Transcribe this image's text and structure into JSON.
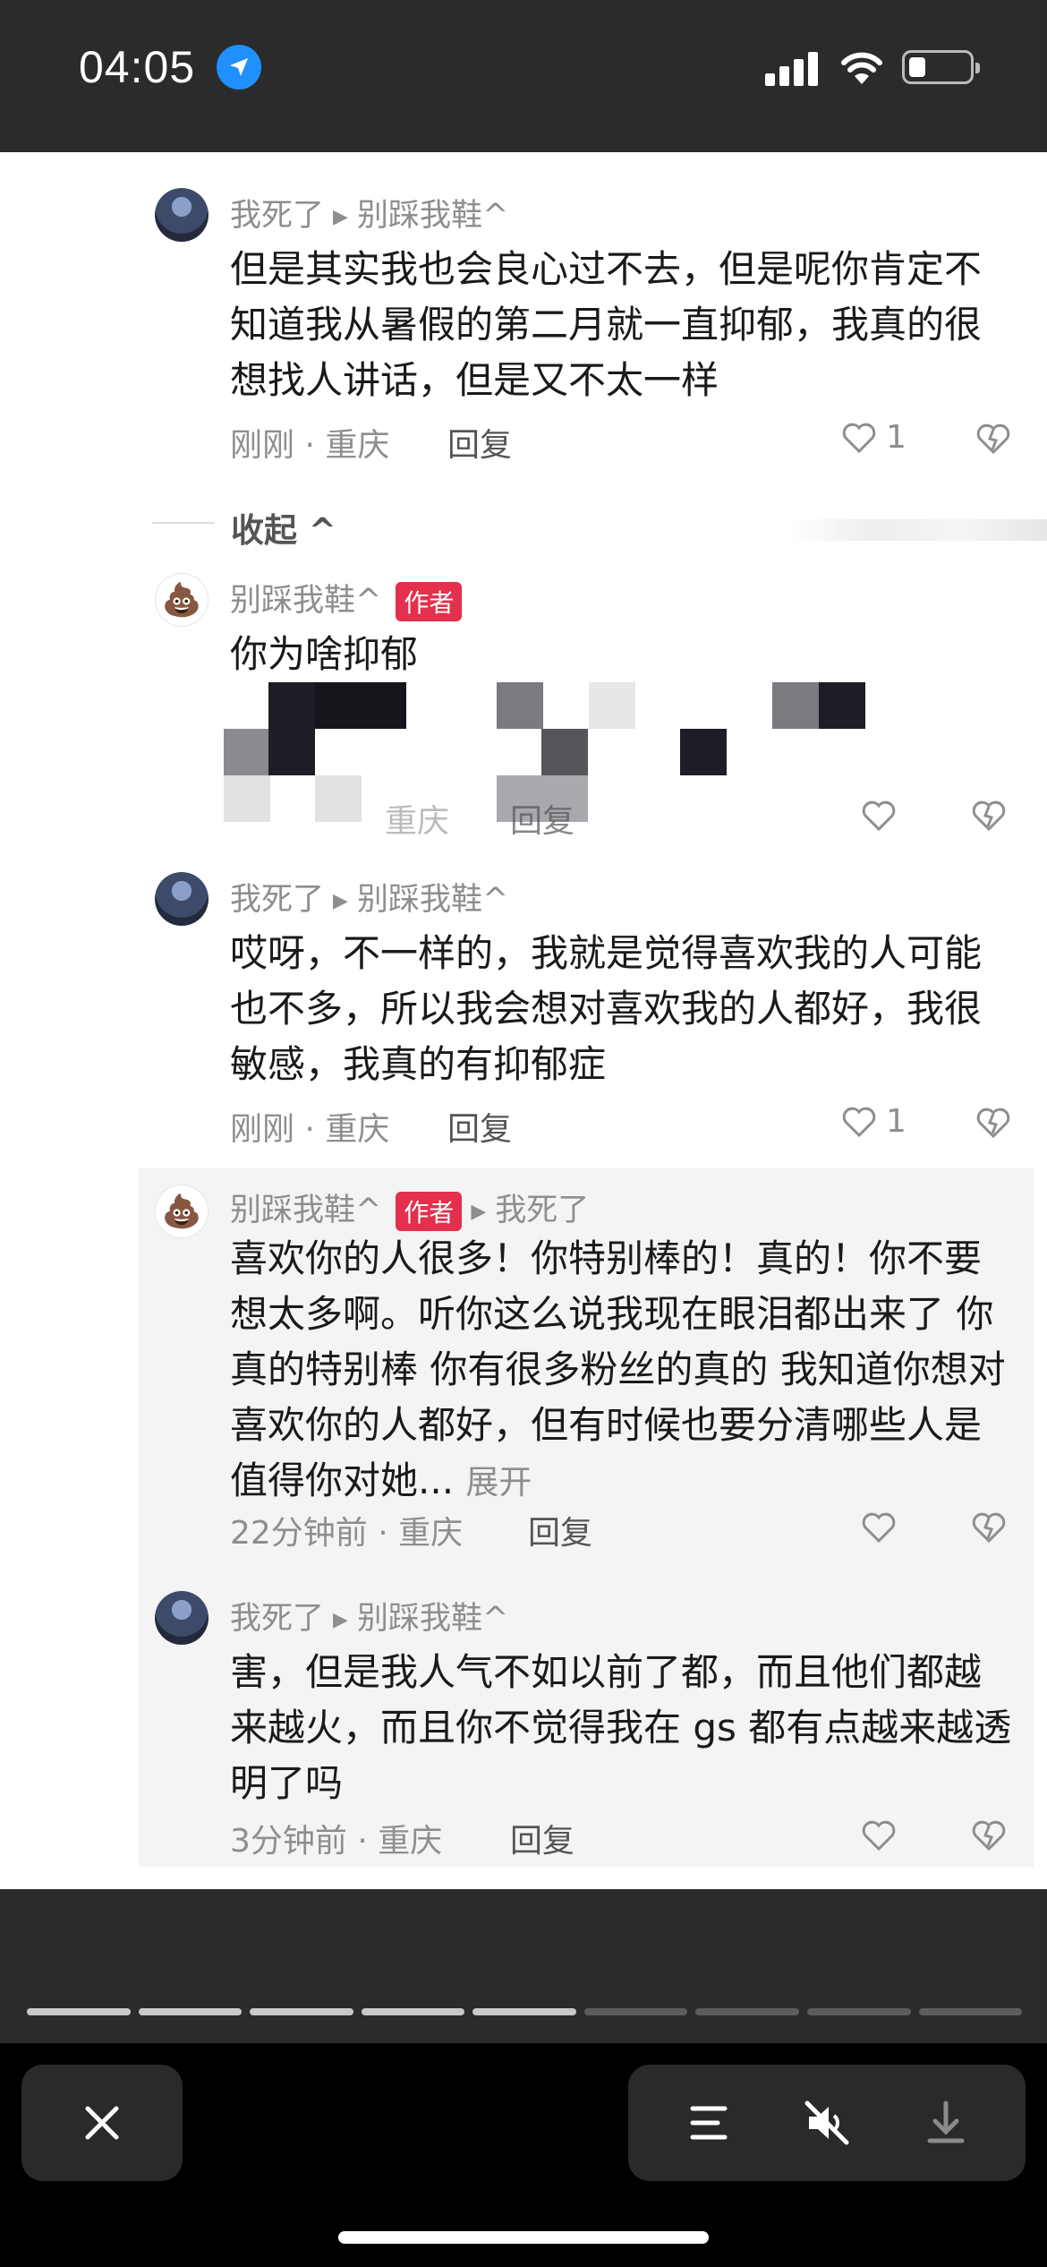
{
  "status_bar": {
    "time": "04:05",
    "battery_level": 0.25
  },
  "comments": [
    {
      "user": "我死了",
      "reply_to": "别踩我鞋^",
      "text": "但是其实我也会良心过不去，但是呢你肯定不知道我从暑假的第二月就一直抑郁，我真的很想找人讲话，但是又不太一样",
      "time_location": "刚刚 · 重庆",
      "reply_label": "回复",
      "likes": "1"
    },
    {
      "user": "别踩我鞋^",
      "author_badge": "作者",
      "text": "你为啥抑郁",
      "time_location": "重庆",
      "reply_label": "回复"
    },
    {
      "user": "我死了",
      "reply_to": "别踩我鞋^",
      "text": "哎呀，不一样的，我就是觉得喜欢我的人可能也不多，所以我会想对喜欢我的人都好，我很敏感，我真的有抑郁症",
      "time_location": "刚刚 · 重庆",
      "reply_label": "回复",
      "likes": "1"
    },
    {
      "user": "别踩我鞋^",
      "author_badge": "作者",
      "reply_to": "我死了",
      "text": "喜欢你的人很多！你特别棒的！真的！你不要想太多啊。听你这么说我现在眼泪都出来了 你真的特别棒 你有很多粉丝的真的 我知道你想对喜欢你的人都好，但有时候也要分清哪些人是值得你对她...",
      "expand_label": "展开",
      "time_location": "22分钟前 · 重庆",
      "reply_label": "回复"
    },
    {
      "user": "我死了",
      "reply_to": "别踩我鞋^",
      "text": "害，但是我人气不如以前了都，而且他们都越来越火，而且你不觉得我在 gs 都有点越来越透明了吗",
      "time_location": "3分钟前 · 重庆",
      "reply_label": "回复"
    }
  ],
  "collapse_label": "收起 ^",
  "story_progress": {
    "segments": 9,
    "completed": 5
  },
  "bottom_bar": {
    "icons": [
      "close-icon",
      "menu-icon",
      "mute-icon",
      "download-icon"
    ]
  }
}
